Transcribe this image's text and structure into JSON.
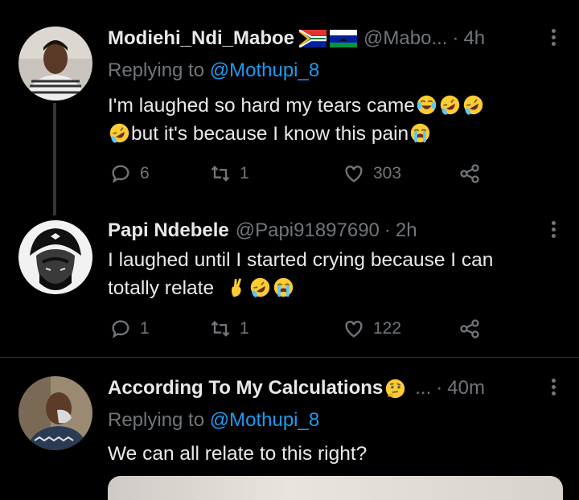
{
  "tweets": [
    {
      "name": "Modiehi_Ndi_Maboe",
      "handle": "@Mabo...",
      "separator": "·",
      "time": "4h",
      "replying_label": "Replying to",
      "replying_to": "@Mothupi_8",
      "text_line1": "I'm laughed so hard my tears came",
      "text_line2": "but it's because I know this pain",
      "replies": "6",
      "retweets": "1",
      "likes": "303"
    },
    {
      "name": "Papi Ndebele",
      "handle": "@Papi91897690",
      "separator": "·",
      "time": "2h",
      "text_line1": "I laughed until I started crying because I can",
      "text_line2": "totally relate",
      "replies": "1",
      "retweets": "1",
      "likes": "122"
    },
    {
      "name": "According To My Calculations",
      "handle": "...",
      "separator": "·",
      "time": "40m",
      "replying_label": "Replying to",
      "replying_to": "@Mothupi_8",
      "text_line1": "We can all relate to this right?"
    }
  ],
  "icons": {
    "reply": "reply-icon",
    "retweet": "retweet-icon",
    "like": "heart-icon",
    "share": "share-icon",
    "more": "more-icon"
  },
  "colors": {
    "background": "#000000",
    "text": "#e7e9ea",
    "secondary": "#71767b",
    "mention": "#1d9bf0"
  }
}
